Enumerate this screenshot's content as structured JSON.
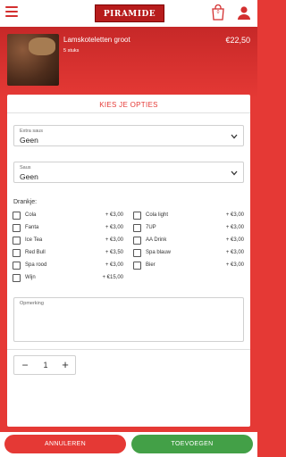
{
  "header": {
    "logo_text": "PIRAMIDE",
    "cart_count": "0"
  },
  "product": {
    "name": "Lamskoteletten groot",
    "subtitle": "5 stuks",
    "price": "€22,50"
  },
  "options": {
    "title": "KIES JE OPTIES",
    "extra_saus": {
      "label": "Extra saus",
      "value": "Geen"
    },
    "saus": {
      "label": "Saus",
      "value": "Geen"
    },
    "drinks_title": "Drankje:",
    "drinks": [
      {
        "name": "Cola",
        "price": "+ €3,00",
        "checked": false
      },
      {
        "name": "Cola light",
        "price": "+ €3,00",
        "checked": false
      },
      {
        "name": "Fanta",
        "price": "+ €3,00",
        "checked": false
      },
      {
        "name": "7UP",
        "price": "+ €3,00",
        "checked": false
      },
      {
        "name": "Ice Tea",
        "price": "+ €3,00",
        "checked": false
      },
      {
        "name": "AA Drink",
        "price": "+ €3,00",
        "checked": false
      },
      {
        "name": "Red Bull",
        "price": "+ €3,50",
        "checked": false
      },
      {
        "name": "Spa blauw",
        "price": "+ €3,00",
        "checked": false
      },
      {
        "name": "Spa rood",
        "price": "+ €3,00",
        "checked": false
      },
      {
        "name": "Bier",
        "price": "+ €3,00",
        "checked": false
      },
      {
        "name": "Wijn",
        "price": "+ €15,00",
        "checked": false
      }
    ],
    "remark_label": "Opmerking",
    "remark_value": "",
    "quantity": "1"
  },
  "footer": {
    "cancel_label": "ANNULEREN",
    "add_label": "TOEVOEGEN"
  },
  "colors": {
    "brand": "#e53935",
    "confirm": "#43a047"
  }
}
